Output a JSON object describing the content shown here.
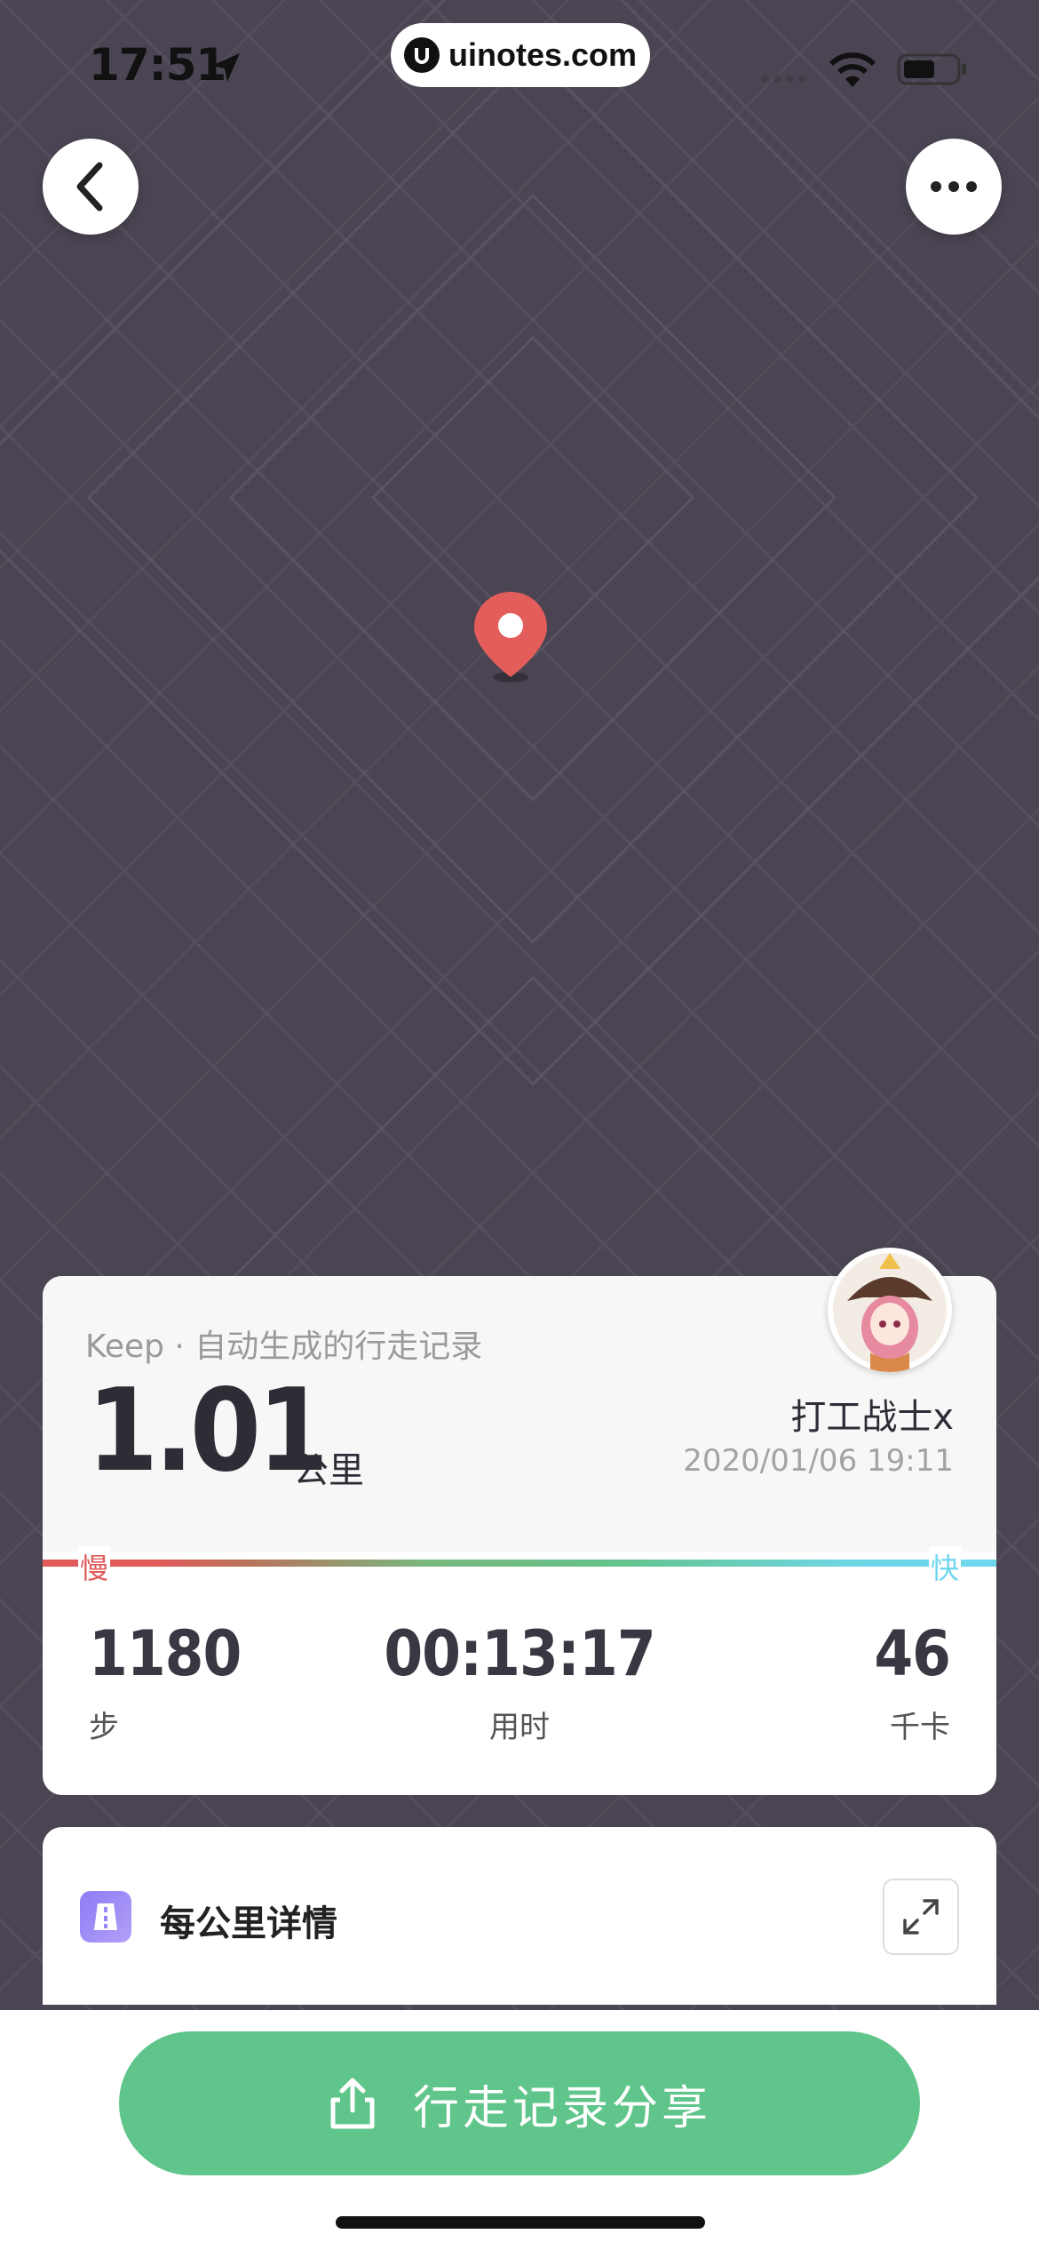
{
  "status_bar": {
    "time": "17:51",
    "url": "uinotes.com"
  },
  "map": {
    "background_color": "#4b4553",
    "pin_color": "#e35d5b"
  },
  "summary": {
    "source": "Keep · 自动生成的行走记录",
    "distance": "1.01",
    "distance_unit": "公里",
    "username": "打工战士x",
    "datetime": "2020/01/06 19:11",
    "pace_slow_label": "慢",
    "pace_fast_label": "快",
    "stats": {
      "steps_value": "1180",
      "steps_label": "步",
      "duration_value": "00:13:17",
      "duration_label": "用时",
      "calories_value": "46",
      "calories_label": "千卡"
    }
  },
  "per_km": {
    "title": "每公里详情"
  },
  "share": {
    "label": "行走记录分享",
    "color": "#5fc58a"
  }
}
